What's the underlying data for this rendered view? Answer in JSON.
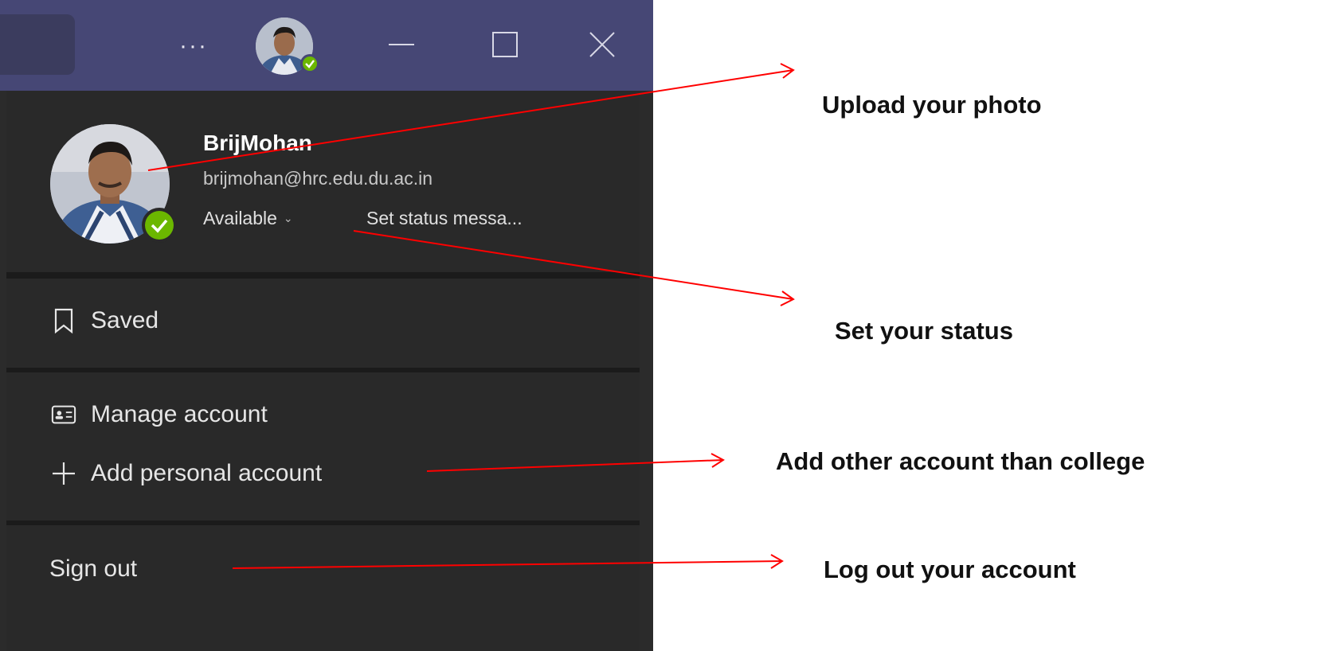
{
  "titlebar": {
    "more_label": "···",
    "avatar_icon": "user-avatar-icon",
    "minimize_icon": "minimize-icon",
    "maximize_icon": "maximize-icon",
    "close_icon": "close-icon",
    "bar_color": "#464775"
  },
  "profile": {
    "name": "BrijMohan",
    "email": "brijmohan@hrc.edu.du.ac.in",
    "status": "Available",
    "status_message": "Set status messa...",
    "presence_color": "#6bb700"
  },
  "menu": {
    "saved": "Saved",
    "manage_account": "Manage account",
    "add_personal_account": "Add personal account",
    "sign_out": "Sign out"
  },
  "annotations": {
    "upload_photo": "Upload your photo",
    "set_status": "Set your status",
    "add_account": "Add other account than college",
    "log_out": "Log out your account",
    "arrow_color": "#ff0000"
  }
}
